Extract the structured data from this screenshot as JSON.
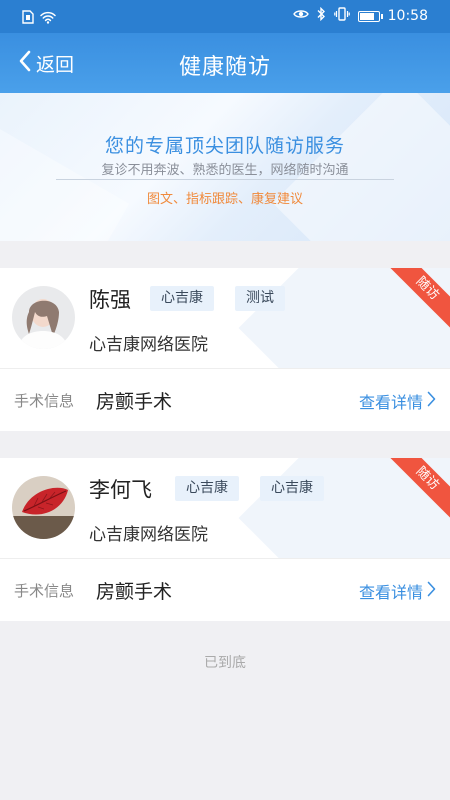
{
  "status_bar": {
    "time": "10:58",
    "battery_level": 0.8
  },
  "nav": {
    "back_label": "返回",
    "title": "健康随访"
  },
  "banner": {
    "title": "您的专属顶尖团队随访服务",
    "subtitle": "复诊不用奔波、熟悉的医生，网络随时沟通",
    "features": "图文、指标跟踪、康复建议"
  },
  "cards": [
    {
      "name": "陈强",
      "tags": [
        "心吉康",
        "测试"
      ],
      "hospital": "心吉康网络医院",
      "ribbon": "随访",
      "info_label": "手术信息",
      "info_value": "房颤手术",
      "detail_label": "查看详情"
    },
    {
      "name": "李何飞",
      "tags": [
        "心吉康",
        "心吉康"
      ],
      "hospital": "心吉康网络医院",
      "ribbon": "随访",
      "info_label": "手术信息",
      "info_value": "房颤手术",
      "detail_label": "查看详情"
    }
  ],
  "footer": {
    "end_text": "已到底"
  },
  "colors": {
    "primary": "#3a8fe0",
    "accent": "#f08a3c",
    "ribbon": "#f0553f"
  }
}
